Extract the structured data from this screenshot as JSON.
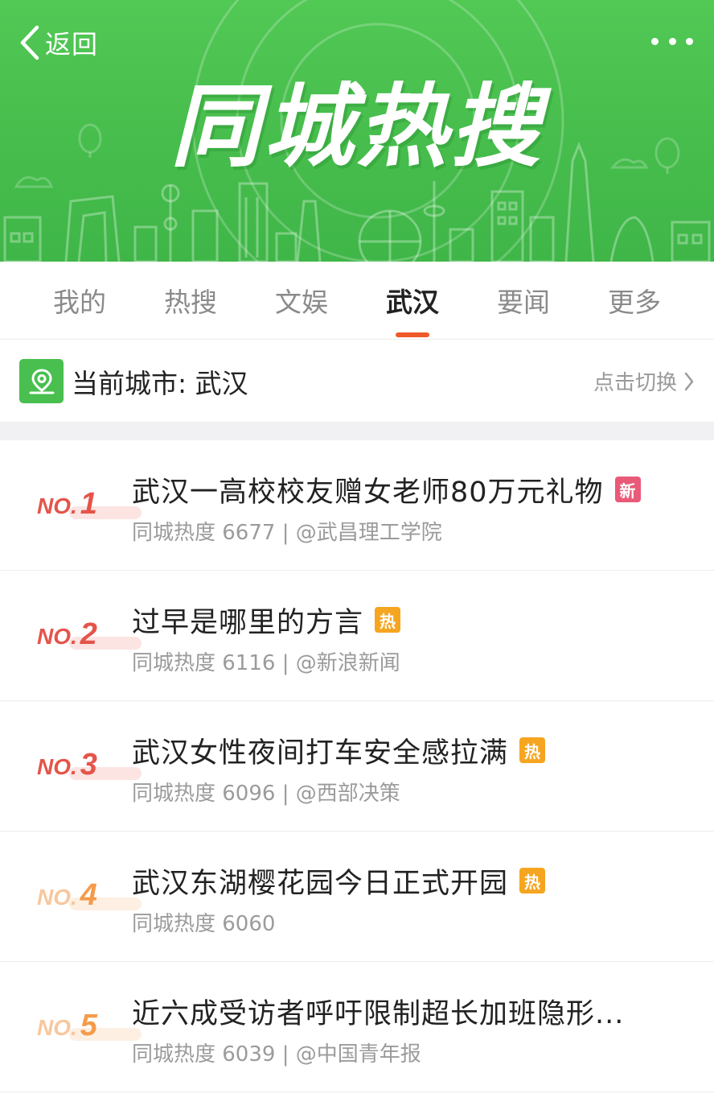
{
  "header": {
    "back_label": "返回",
    "banner_title": "同城热搜",
    "more_icon": "more-dots-icon",
    "colors": {
      "banner_green": "#46bd4c",
      "accent_orange": "#f05a2a"
    }
  },
  "tabs": [
    {
      "label": "我的",
      "active": false
    },
    {
      "label": "热搜",
      "active": false
    },
    {
      "label": "文娱",
      "active": false
    },
    {
      "label": "武汉",
      "active": true
    },
    {
      "label": "要闻",
      "active": false
    },
    {
      "label": "更多",
      "active": false
    }
  ],
  "city_bar": {
    "label": "当前城市: 武汉",
    "switch_label": "点击切换",
    "icon": "location-pin-icon"
  },
  "list": [
    {
      "rank_prefix": "NO.",
      "rank_num": "1",
      "title": "武汉一高校校友赠女老师80万元礼物",
      "badge": "新",
      "badge_type": "new",
      "subtitle": "同城热度 6677 | @武昌理工学院"
    },
    {
      "rank_prefix": "NO.",
      "rank_num": "2",
      "title": "过早是哪里的方言",
      "badge": "热",
      "badge_type": "hot",
      "subtitle": "同城热度 6116 | @新浪新闻"
    },
    {
      "rank_prefix": "NO.",
      "rank_num": "3",
      "title": "武汉女性夜间打车安全感拉满",
      "badge": "热",
      "badge_type": "hot",
      "subtitle": "同城热度 6096 | @西部决策"
    },
    {
      "rank_prefix": "NO.",
      "rank_num": "4",
      "title": "武汉东湖樱花园今日正式开园",
      "badge": "热",
      "badge_type": "hot",
      "subtitle": "同城热度 6060"
    },
    {
      "rank_prefix": "NO.",
      "rank_num": "5",
      "title": "近六成受访者呼吁限制超长加班隐形...",
      "badge": "",
      "badge_type": "",
      "subtitle": "同城热度 6039 | @中国青年报"
    }
  ]
}
